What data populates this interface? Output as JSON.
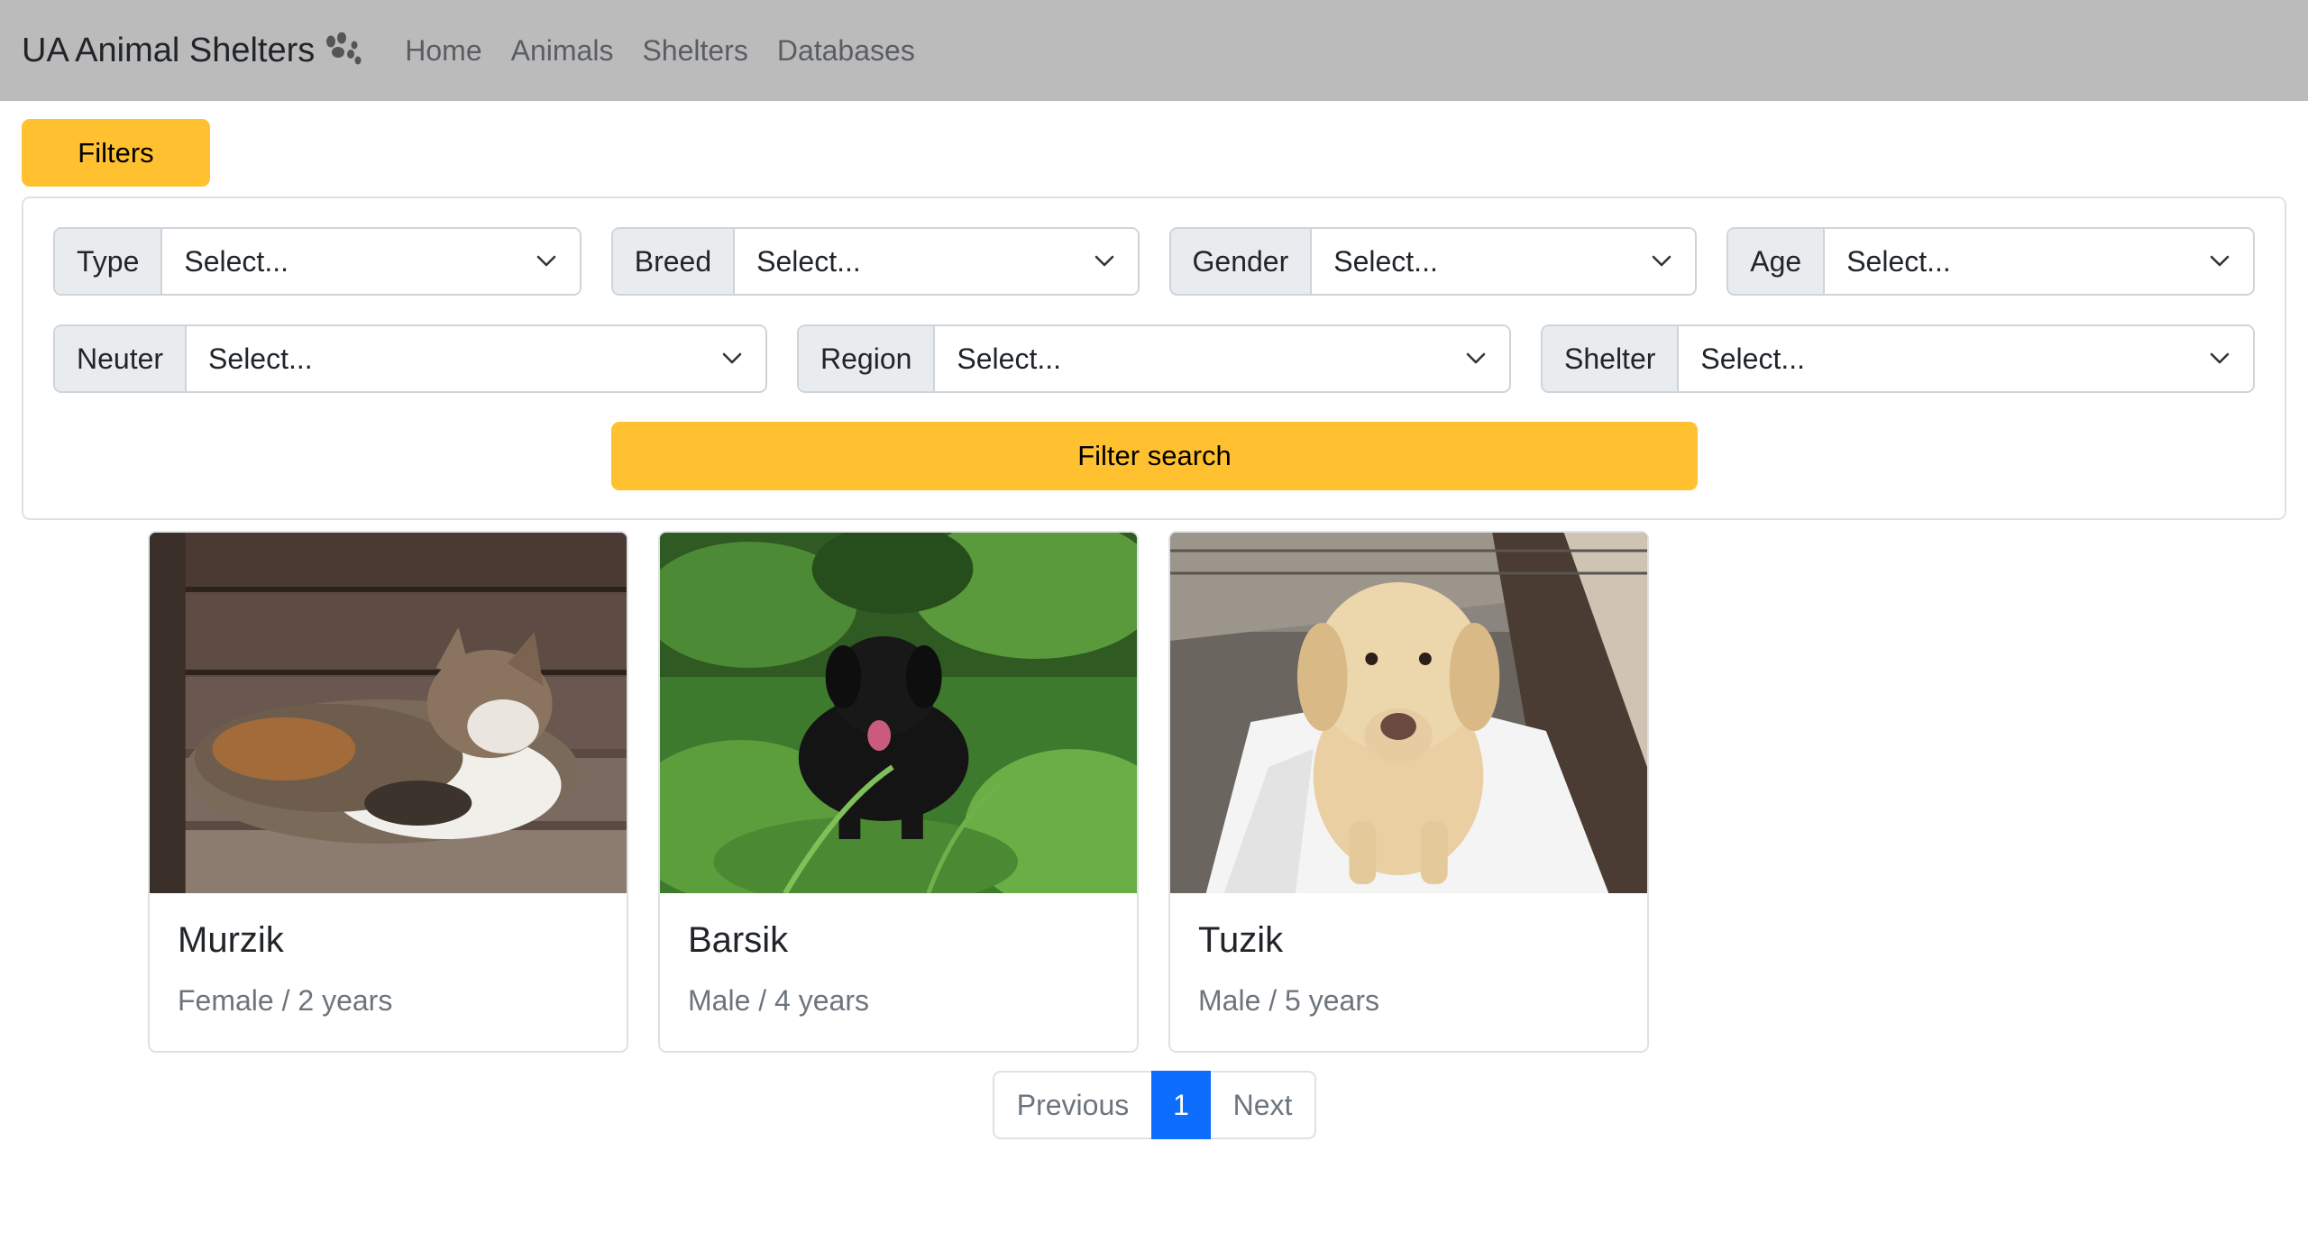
{
  "navbar": {
    "brand": "UA Animal Shelters",
    "brand_icon": "paw-icon",
    "links": [
      "Home",
      "Animals",
      "Shelters",
      "Databases"
    ]
  },
  "filters_toggle": {
    "label": "Filters"
  },
  "filters": {
    "row1": [
      {
        "label": "Type",
        "value": "Select..."
      },
      {
        "label": "Breed",
        "value": "Select..."
      },
      {
        "label": "Gender",
        "value": "Select..."
      },
      {
        "label": "Age",
        "value": "Select..."
      }
    ],
    "row2": [
      {
        "label": "Neuter",
        "value": "Select..."
      },
      {
        "label": "Region",
        "value": "Select..."
      },
      {
        "label": "Shelter",
        "value": "Select..."
      }
    ],
    "search_label": "Filter search"
  },
  "animals": [
    {
      "name": "Murzik",
      "details": "Female / 2 years",
      "photo": "calico cat lying on wooden bench"
    },
    {
      "name": "Barsik",
      "details": "Male / 4 years",
      "photo": "black labrador sitting in green grass"
    },
    {
      "name": "Tuzik",
      "details": "Male / 5 years",
      "photo": "yellow labrador sitting on white blanket"
    }
  ],
  "pagination": {
    "previous": "Previous",
    "current": "1",
    "next": "Next"
  },
  "colors": {
    "navbar_bg": "#bbbbbb",
    "accent": "#ffc12f",
    "page_active": "#0d6efd"
  }
}
